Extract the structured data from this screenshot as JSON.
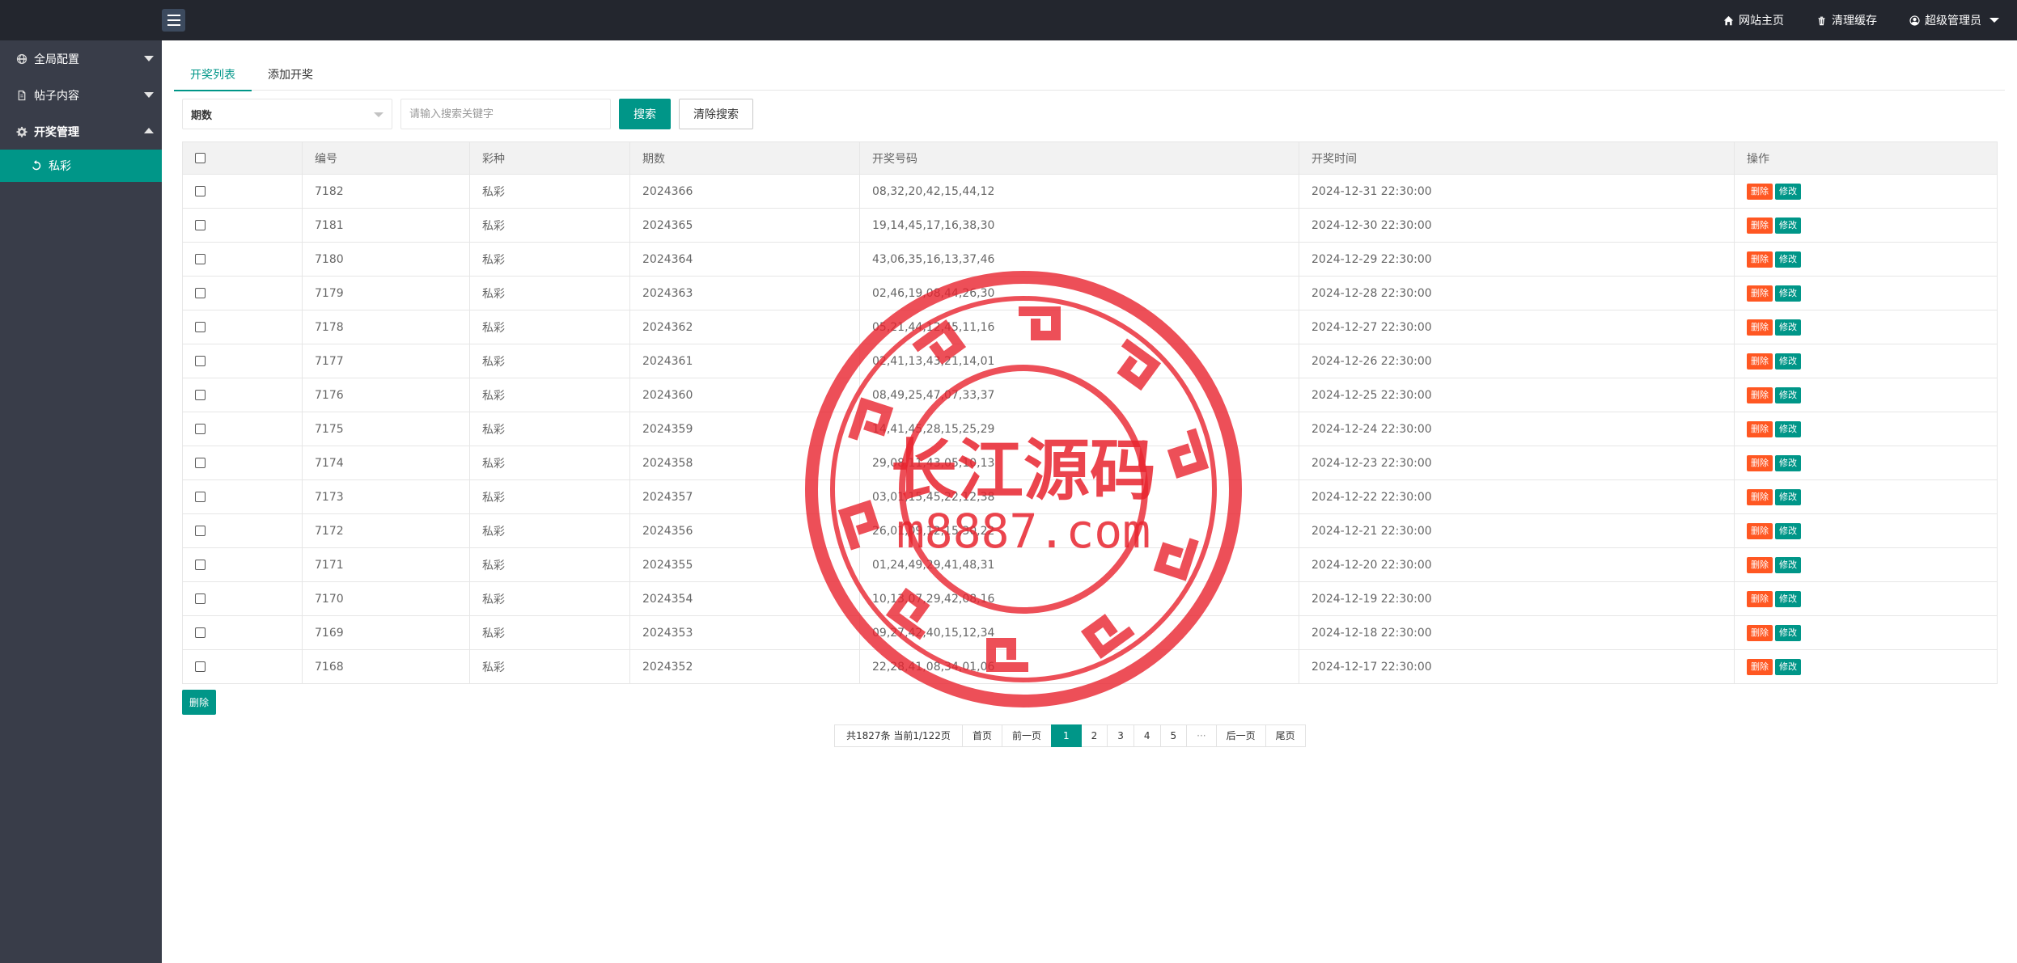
{
  "topbar": {
    "home_label": "网站主页",
    "cache_label": "清理缓存",
    "user_label": "超级管理员"
  },
  "sidebar": {
    "items": [
      {
        "label": "全局配置",
        "icon": "globe-icon"
      },
      {
        "label": "帖子内容",
        "icon": "document-icon"
      },
      {
        "label": "开奖管理",
        "icon": "gear-icon"
      }
    ],
    "sub_items": [
      {
        "label": "私彩",
        "icon": "refresh-icon"
      }
    ]
  },
  "tabs": [
    {
      "label": "开奖列表",
      "active": true
    },
    {
      "label": "添加开奖",
      "active": false
    }
  ],
  "search": {
    "select_value": "期数",
    "placeholder": "请输入搜索关键字",
    "search_label": "搜索",
    "clear_label": "清除搜索"
  },
  "table": {
    "headers": [
      "编号",
      "彩种",
      "期数",
      "开奖号码",
      "开奖时间",
      "操作"
    ],
    "delete_label": "删除",
    "edit_label": "修改",
    "rows": [
      {
        "id": "7182",
        "type": "私彩",
        "period": "2024366",
        "numbers": "08,32,20,42,15,44,12",
        "time": "2024-12-31 22:30:00"
      },
      {
        "id": "7181",
        "type": "私彩",
        "period": "2024365",
        "numbers": "19,14,45,17,16,38,30",
        "time": "2024-12-30 22:30:00"
      },
      {
        "id": "7180",
        "type": "私彩",
        "period": "2024364",
        "numbers": "43,06,35,16,13,37,46",
        "time": "2024-12-29 22:30:00"
      },
      {
        "id": "7179",
        "type": "私彩",
        "period": "2024363",
        "numbers": "02,46,19,08,44,26,30",
        "time": "2024-12-28 22:30:00"
      },
      {
        "id": "7178",
        "type": "私彩",
        "period": "2024362",
        "numbers": "05,21,44,12,45,11,16",
        "time": "2024-12-27 22:30:00"
      },
      {
        "id": "7177",
        "type": "私彩",
        "period": "2024361",
        "numbers": "02,41,13,43,21,14,01",
        "time": "2024-12-26 22:30:00"
      },
      {
        "id": "7176",
        "type": "私彩",
        "period": "2024360",
        "numbers": "08,49,25,47,07,33,37",
        "time": "2024-12-25 22:30:00"
      },
      {
        "id": "7175",
        "type": "私彩",
        "period": "2024359",
        "numbers": "14,41,45,28,15,25,29",
        "time": "2024-12-24 22:30:00"
      },
      {
        "id": "7174",
        "type": "私彩",
        "period": "2024358",
        "numbers": "29,08,11,43,05,10,13",
        "time": "2024-12-23 22:30:00"
      },
      {
        "id": "7173",
        "type": "私彩",
        "period": "2024357",
        "numbers": "03,01,15,45,22,12,38",
        "time": "2024-12-22 22:30:00"
      },
      {
        "id": "7172",
        "type": "私彩",
        "period": "2024356",
        "numbers": "26,01,09,12,15,30,22",
        "time": "2024-12-21 22:30:00"
      },
      {
        "id": "7171",
        "type": "私彩",
        "period": "2024355",
        "numbers": "01,24,49,29,41,48,31",
        "time": "2024-12-20 22:30:00"
      },
      {
        "id": "7170",
        "type": "私彩",
        "period": "2024354",
        "numbers": "10,13,07,29,42,08,16",
        "time": "2024-12-19 22:30:00"
      },
      {
        "id": "7169",
        "type": "私彩",
        "period": "2024353",
        "numbers": "09,27,42,40,15,12,34",
        "time": "2024-12-18 22:30:00"
      },
      {
        "id": "7168",
        "type": "私彩",
        "period": "2024352",
        "numbers": "22,28,41,08,34,01,06",
        "time": "2024-12-17 22:30:00"
      }
    ]
  },
  "bulk_delete_label": "删除",
  "pagination": {
    "info": "共1827条 当前1/122页",
    "first": "首页",
    "prev": "前一页",
    "pages": [
      "1",
      "2",
      "3",
      "4",
      "5"
    ],
    "current": "1",
    "ellipsis": "···",
    "next": "后一页",
    "last": "尾页"
  },
  "watermark": {
    "title": "长江源码",
    "url": "m8887.com",
    "color": "#e8232e"
  },
  "colors": {
    "topbar": "#23262e",
    "sidebar": "#393d49",
    "accent": "#009688",
    "danger": "#ff5722"
  }
}
